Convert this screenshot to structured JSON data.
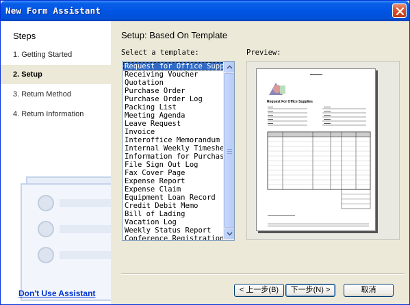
{
  "window": {
    "title": "New Form Assistant"
  },
  "sidebar": {
    "title": "Steps",
    "steps": [
      {
        "label": "1. Getting Started",
        "active": false
      },
      {
        "label": "2. Setup",
        "active": true
      },
      {
        "label": "3. Return Method",
        "active": false
      },
      {
        "label": "4. Return Information",
        "active": false
      }
    ],
    "dont_use_link": "Don't Use Assistant"
  },
  "main": {
    "heading": "Setup: Based On Template",
    "select_label": "Select a template:",
    "preview_label": "Preview:",
    "templates": [
      "Request for Office Suppl",
      "Receiving Voucher",
      "Quotation",
      "Purchase Order",
      "Purchase Order Log",
      "Packing List",
      "Meeting Agenda",
      "Leave Request",
      "Invoice",
      "Interoffice Memorandum",
      "Internal Weekly Timeshee",
      "Information for Purchase",
      "File Sign Out Log",
      "Fax Cover Page",
      "Expense Report",
      "Expense Claim",
      "Equipment Loan Record",
      "Credit Debit Memo",
      "Bill of Lading",
      "Vacation Log",
      "Weekly Status Report",
      "Conference Registration"
    ],
    "selected_index": 0,
    "preview_doc_title": "Request For Office Supplies"
  },
  "buttons": {
    "back": "< 上一步(B)",
    "next": "下一步(N) >",
    "cancel": "取消"
  }
}
